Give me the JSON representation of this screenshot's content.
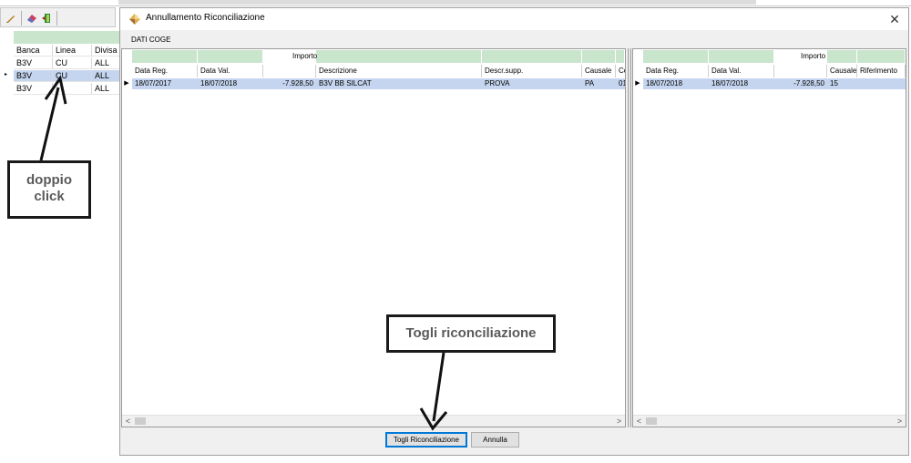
{
  "background_app": {
    "grid": {
      "columns": [
        "Banca",
        "Linea",
        "Divisa"
      ],
      "rows": [
        {
          "banca": "B3V",
          "linea": "CU",
          "divisa": "ALL"
        },
        {
          "banca": "B3V",
          "linea": "CU",
          "divisa": "ALL"
        },
        {
          "banca": "B3V",
          "linea": "",
          "divisa": "ALL"
        }
      ]
    }
  },
  "dialog": {
    "title": "Annullamento Riconciliazione",
    "close_glyph": "✕",
    "section_label": "DATI COGE",
    "left_grid": {
      "top_header": "Importo",
      "columns": [
        "Data Reg.",
        "Data Val.",
        "",
        "Descrizione",
        "Descr.supp.",
        "Causale",
        "Co"
      ],
      "row": {
        "data_reg": "18/07/2017",
        "data_val": "18/07/2018",
        "importo": "-7.928,50",
        "descrizione": "B3V BB SILCAT",
        "descr_supp": "PROVA",
        "causale": "PA",
        "co": "01"
      }
    },
    "right_grid": {
      "top_header": "Importo",
      "columns": [
        "Data Reg.",
        "Data Val.",
        "",
        "Causale",
        "Riferimento"
      ],
      "row": {
        "data_reg": "18/07/2018",
        "data_val": "18/07/2018",
        "importo": "-7.928,50",
        "causale": "15",
        "riferimento": ""
      }
    },
    "scroll_left": "<",
    "scroll_right": ">",
    "buttons": {
      "primary": "Togli Riconciliazione",
      "secondary": "Annulla"
    }
  },
  "annotations": {
    "doppio_line1": "doppio",
    "doppio_line2": "click",
    "togli": "Togli riconciliazione"
  },
  "colors": {
    "header_green": "#c9e5cc",
    "selection_blue": "#c5d5ef",
    "accent": "#0078d7"
  }
}
